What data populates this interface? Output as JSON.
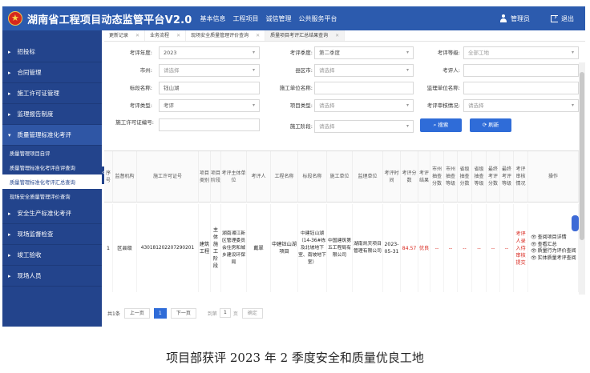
{
  "app": {
    "title": "湖南省工程项目动态监管平台V2.0",
    "nav": [
      "基本信息",
      "工程项目",
      "诚信管理",
      "公共服务平台"
    ],
    "user_label": "管理员",
    "logout_label": "退出"
  },
  "sidebar": {
    "items": [
      {
        "label": "招投标"
      },
      {
        "label": "合同管理"
      },
      {
        "label": "施工许可证管理"
      },
      {
        "label": "监理报告制度"
      },
      {
        "label": "质量管理标准化考评"
      }
    ],
    "sub_items": [
      {
        "label": "质量管理项目自评"
      },
      {
        "label": "质量管理标准化考评自评查询"
      },
      {
        "label": "质量管理标准化考评汇总查询"
      },
      {
        "label": "现场安全质量管理评价查询"
      }
    ],
    "items_after": [
      {
        "label": "安全生产标准化考评"
      },
      {
        "label": "现场监督检查"
      },
      {
        "label": "竣工验收"
      },
      {
        "label": "现场人员"
      }
    ]
  },
  "tabs": [
    "更新记录",
    "业务流程",
    "现场安全质量管理评价查询",
    "质量项目考评汇总结果查询"
  ],
  "form": {
    "year_label": "考评年度:",
    "year_value": "2023",
    "quarter_label": "考评季度:",
    "quarter_value": "第二季度",
    "grade_label": "考评等级:",
    "grade_value": "全部工地",
    "city_label": "市州:",
    "city_value": "请选择",
    "county_label": "县区市:",
    "county_value": "请选择",
    "evaluator_label": "考评人:",
    "evaluator_value": "",
    "section_label": "标段名称:",
    "section_value": "钰山湖",
    "contractor_label": "施工单位名称:",
    "contractor_value": "",
    "supervisor_label": "监理单位名称:",
    "supervisor_value": "",
    "type_label": "考评类型:",
    "type_value": "考评",
    "project_type_label": "项目类型:",
    "project_type_value": "请选择",
    "audit_label": "考评审核情况:",
    "audit_value": "请选择",
    "permit_label": "施工许可证编号:",
    "permit_value": "",
    "stage_label": "施工阶段:",
    "stage_value": "请选择",
    "search_label": "搜索",
    "refresh_label": "刷新"
  },
  "table": {
    "headers": [
      "序号",
      "监督机构",
      "施工许可证号",
      "项目类别",
      "项目阶段",
      "考评主体单位",
      "考评人",
      "工程名称",
      "标段名称",
      "施工单位",
      "监理单位",
      "考评时间",
      "考评分数",
      "考评结果",
      "市州抽查分数",
      "市州抽查等级",
      "省级抽查分数",
      "省级抽查等级",
      "最终考评分数",
      "最终考评等级",
      "考评审核情况",
      "操作"
    ],
    "rows": [
      {
        "no": "1",
        "agency": "区县级",
        "permit": "430181202207290201",
        "category": "建筑工程",
        "stage": "主体施工阶段",
        "unit": "湖南湘江新区管理委员会住房和城乡建设环保局",
        "evaluator": "戴翠",
        "project": "中建钰山湖项目",
        "section": "中建钰山湖（14-36#栋及北坡地下室、南坡地下室）",
        "contractor": "中国建筑第五工程局有限公司",
        "supervisor": "湖南凯天项目管理有限公司",
        "date": "2023-05-31",
        "score": "84.57",
        "result": "优良",
        "city_score": "--",
        "city_grade": "--",
        "prov_score": "--",
        "prov_grade": "--",
        "final_score": "--",
        "final_grade": "--",
        "audit": "考评人录入待审核提交",
        "ops": [
          "查阅项目详情",
          "查看汇总",
          "质量行为评价查阅",
          "实体质量考评查阅"
        ]
      }
    ]
  },
  "pager": {
    "total": "共1条",
    "prev": "上一页",
    "page": "1",
    "next": "下一页",
    "goto": "到第",
    "goto_value": "1",
    "page_unit": "页",
    "confirm": "确定"
  },
  "caption": "项目部获评 2023 年 2 季度安全和质量优良工地"
}
